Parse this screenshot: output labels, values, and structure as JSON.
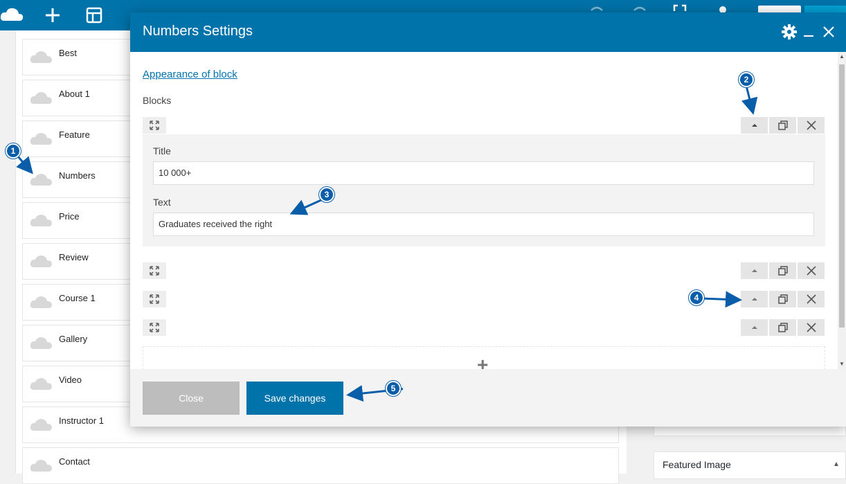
{
  "modal": {
    "title": "Numbers Settings",
    "appearance_link": "Appearance of block",
    "blocks_label": "Blocks",
    "expanded_block": {
      "title_label": "Title",
      "title_value": "10 000+",
      "text_label": "Text",
      "text_value": "Graduates received the right"
    },
    "collapsed_block_count": 3,
    "footer": {
      "close_label": "Close",
      "save_label": "Save changes"
    }
  },
  "left_list": {
    "items": [
      "Best",
      "About 1",
      "Feature",
      "Numbers",
      "Price",
      "Review",
      "Course 1",
      "Gallery",
      "Video",
      "Instructor 1",
      "Contact"
    ]
  },
  "right_panel": {
    "featured_image_title": "Featured Image"
  },
  "annotations": {
    "badge_1": "1",
    "badge_2": "2",
    "badge_3": "3",
    "badge_4": "4",
    "badge_5": "5"
  },
  "colors": {
    "brand": "#0073aa",
    "annotation": "#0a5da8",
    "close_button": "#bdbdbd"
  }
}
